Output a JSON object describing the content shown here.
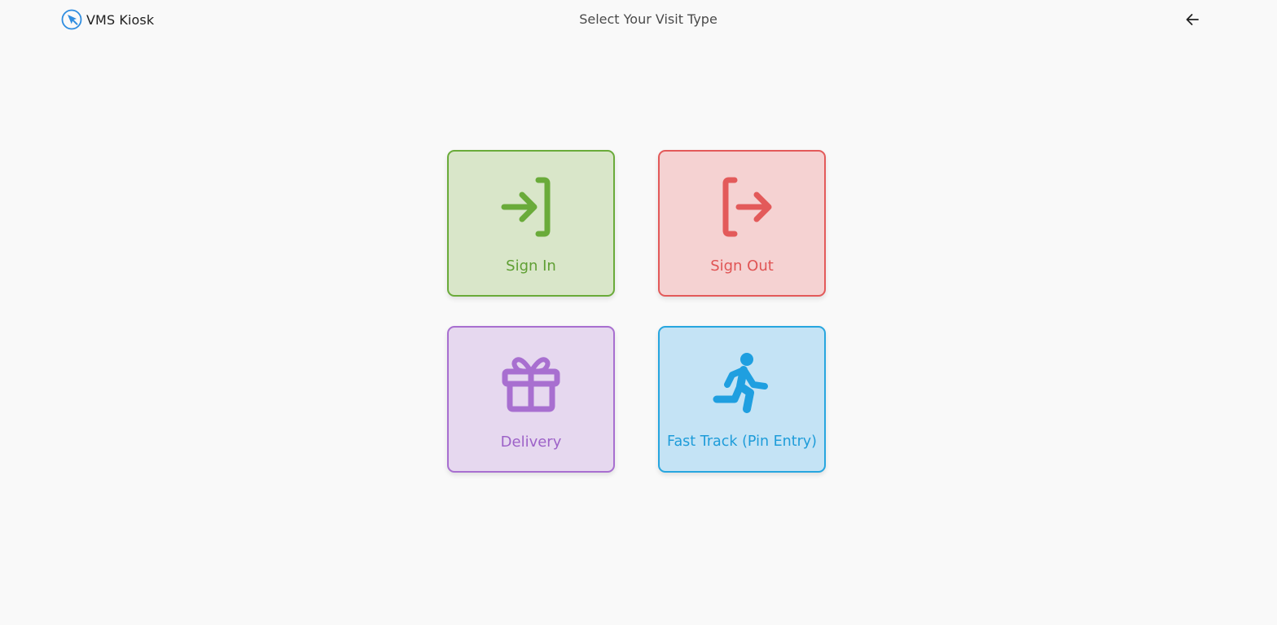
{
  "app": {
    "name": "VMS Kiosk",
    "logo_icon": "cursor-click-icon",
    "accent": "#2f8de0"
  },
  "header": {
    "title": "Select Your Visit Type",
    "back_icon": "arrow-left-icon"
  },
  "options": [
    {
      "label": "Sign In",
      "icon": "login-arrow-icon",
      "color": "#6aab3a",
      "background": "#d9e6c9"
    },
    {
      "label": "Sign Out",
      "icon": "logout-arrow-icon",
      "color": "#e35a5a",
      "background": "#f5d2d2"
    },
    {
      "label": "Delivery",
      "icon": "gift-icon",
      "color": "#a86fd0",
      "background": "#e6d8ef"
    },
    {
      "label": "Fast Track (Pin Entry)",
      "icon": "running-person-icon",
      "color": "#27a6df",
      "background": "#c4e3f5"
    }
  ]
}
